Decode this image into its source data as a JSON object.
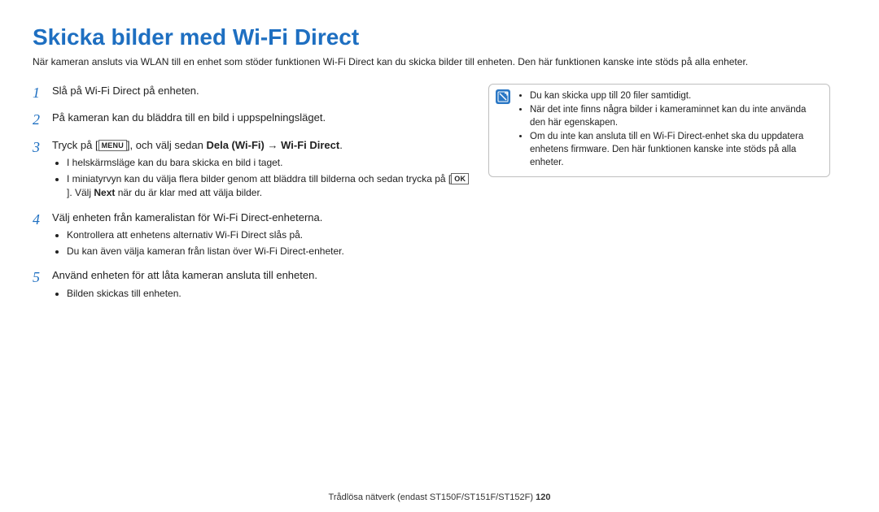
{
  "title": "Skicka bilder med Wi-Fi Direct",
  "intro": "När kameran ansluts via WLAN till en enhet som stöder funktionen Wi-Fi Direct kan du skicka bilder till enheten. Den här funktionen kanske inte stöds på alla enheter.",
  "steps": {
    "s1": {
      "num": "1",
      "text": "Slå på Wi-Fi Direct på enheten."
    },
    "s2": {
      "num": "2",
      "text": "På kameran kan du bläddra till en bild i uppspelningsläget."
    },
    "s3": {
      "num": "3",
      "prefix": "Tryck på [",
      "menu_key": "MENU",
      "mid": "], och välj sedan ",
      "bold1": "Dela (Wi-Fi)",
      "arrow": " → ",
      "bold2": "Wi-Fi Direct",
      "suffix": ".",
      "bullet1": "I helskärmsläge kan du bara skicka en bild i taget.",
      "bullet2a": "I miniatyrvyn kan du välja flera bilder genom att bläddra till bilderna och sedan trycka på [",
      "ok_key": "OK",
      "bullet2b": "]. Välj ",
      "bullet2_bold": "Next",
      "bullet2c": " när du är klar med att välja bilder."
    },
    "s4": {
      "num": "4",
      "text": "Välj enheten från kameralistan för Wi-Fi Direct-enheterna.",
      "bullet1": "Kontrollera att enhetens alternativ Wi-Fi Direct slås på.",
      "bullet2": "Du kan även välja kameran från listan över Wi-Fi Direct-enheter."
    },
    "s5": {
      "num": "5",
      "text": "Använd enheten för att låta kameran ansluta till enheten.",
      "bullet1": "Bilden skickas till enheten."
    }
  },
  "infobox": {
    "b1": "Du kan skicka upp till 20 filer samtidigt.",
    "b2": "När det inte finns några bilder i kameraminnet kan du inte använda den här egenskapen.",
    "b3": "Om du inte kan ansluta till en Wi-Fi Direct-enhet ska du uppdatera enhetens firmware. Den här funktionen kanske inte stöds på alla enheter."
  },
  "footer": {
    "text": "Trådlösa nätverk (endast ST150F/ST151F/ST152F)  ",
    "page": "120"
  }
}
